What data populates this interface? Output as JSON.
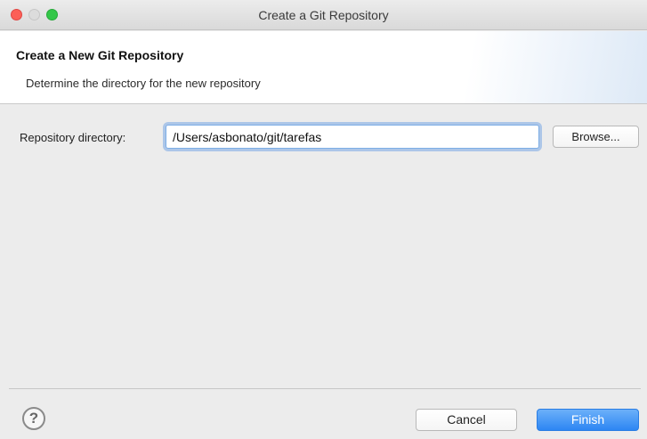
{
  "window": {
    "title": "Create a Git Repository",
    "controls": [
      "close",
      "minimize",
      "zoom"
    ]
  },
  "header": {
    "title": "Create a New Git Repository",
    "description": "Determine the directory for the new repository"
  },
  "form": {
    "directory_label": "Repository directory:",
    "directory_value": "/Users/asbonato/git/tarefas",
    "browse_label": "Browse..."
  },
  "footer": {
    "help_icon": "?",
    "cancel_label": "Cancel",
    "finish_label": "Finish"
  },
  "colors": {
    "finish_button": "#2d86f3",
    "focus_ring": "#7eaee6",
    "close_light": "#fc5f57",
    "zoom_light": "#33c748"
  }
}
